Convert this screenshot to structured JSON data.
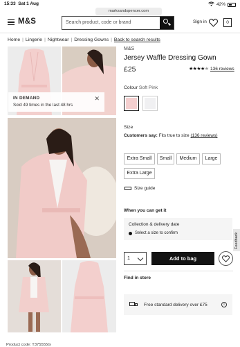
{
  "status": {
    "time": "15:33",
    "date": "Sat 1 Aug",
    "battery": "42%"
  },
  "browser": {
    "url": "marksandspencer.com"
  },
  "header": {
    "logo": "M&S",
    "search_placeholder": "Search product, code or brand",
    "signin": "Sign in",
    "bag_count": "0"
  },
  "breadcrumb": {
    "items": [
      "Home",
      "Lingerie",
      "Nightwear",
      "Dressing Gowns"
    ],
    "back": "Back to search results"
  },
  "gallery": {
    "badge_title": "IN DEMAND",
    "badge_text": "Sold 49 times in the last 48 hrs"
  },
  "product": {
    "brand": "M&S",
    "title": "Jersey Waffle Dressing Gown",
    "price": "£25",
    "rating": 4.5,
    "reviews_link": "136 reviews",
    "colour_label": "Colour",
    "colour_value": "Soft Pink",
    "swatch_colors": [
      "#f4cfcf",
      "#f0f0f2"
    ],
    "size_label": "Size",
    "fit_label": "Customers say:",
    "fit_text": "Fits true to size",
    "fit_reviews": "(136 reviews)",
    "sizes": [
      "Extra Small",
      "Small",
      "Medium",
      "Large",
      "Extra Large"
    ],
    "size_guide": "Size guide"
  },
  "purchase": {
    "when_title": "When you can get it",
    "collection_title": "Collection & delivery date",
    "collection_note": "Select a size to confirm",
    "qty": "1",
    "add_to_bag": "Add to bag",
    "find_in_store": "Find in store",
    "delivery_text": "Free standard delivery over £75",
    "info_icon": "i"
  },
  "feedback": "Feedback",
  "footer": {
    "product_code": "Product code: T375555G"
  }
}
